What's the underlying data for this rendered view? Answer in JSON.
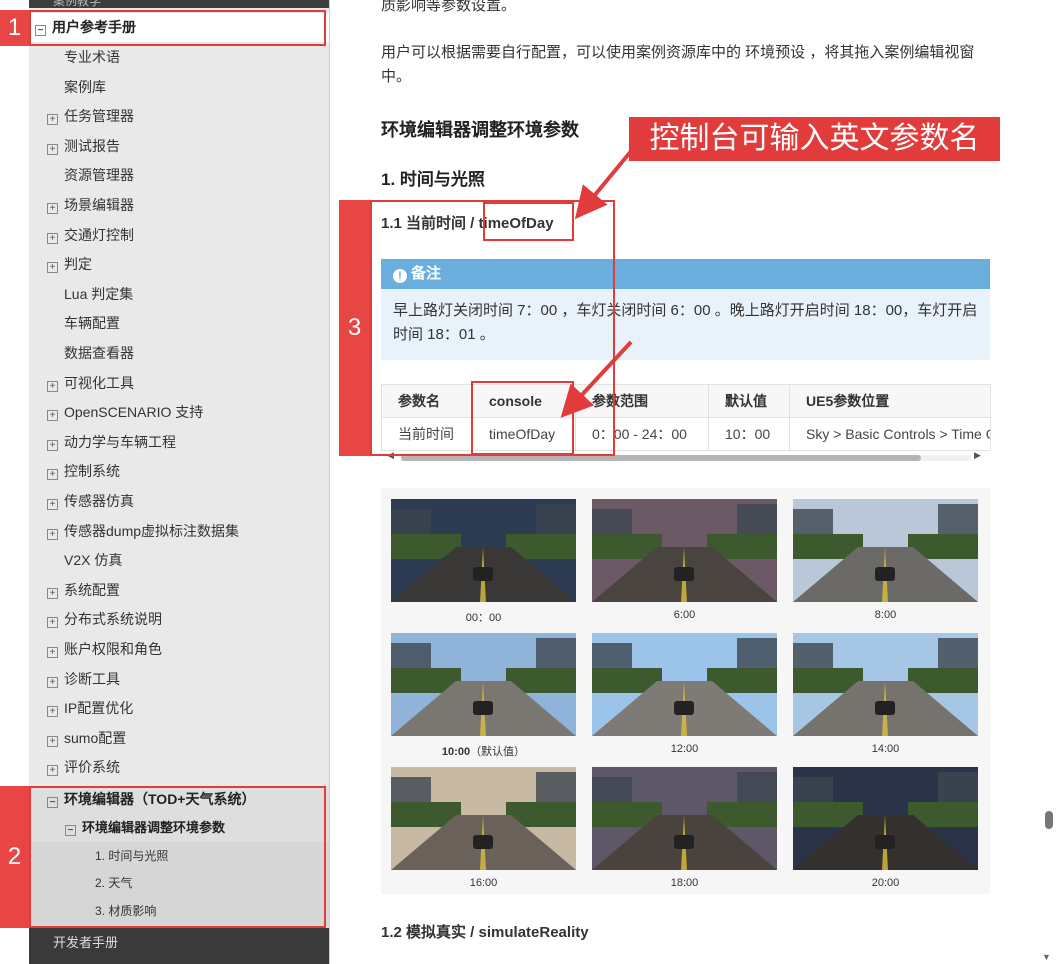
{
  "sidebar": {
    "top_partial": "案例教学",
    "root": "用户参考手册",
    "items": [
      {
        "label": "专业术语",
        "expandable": false
      },
      {
        "label": "案例库",
        "expandable": false
      },
      {
        "label": "任务管理器",
        "expandable": true
      },
      {
        "label": "测试报告",
        "expandable": true
      },
      {
        "label": "资源管理器",
        "expandable": false
      },
      {
        "label": "场景编辑器",
        "expandable": true
      },
      {
        "label": "交通灯控制",
        "expandable": true
      },
      {
        "label": "判定",
        "expandable": true
      },
      {
        "label": "Lua 判定集",
        "expandable": false
      },
      {
        "label": "车辆配置",
        "expandable": false
      },
      {
        "label": "数据查看器",
        "expandable": false
      },
      {
        "label": "可视化工具",
        "expandable": true
      },
      {
        "label": "OpenSCENARIO 支持",
        "expandable": true
      },
      {
        "label": "动力学与车辆工程",
        "expandable": true
      },
      {
        "label": "控制系统",
        "expandable": true
      },
      {
        "label": "传感器仿真",
        "expandable": true
      },
      {
        "label": "传感器dump虚拟标注数据集",
        "expandable": true
      },
      {
        "label": "V2X 仿真",
        "expandable": false
      },
      {
        "label": "系统配置",
        "expandable": true
      },
      {
        "label": "分布式系统说明",
        "expandable": true
      },
      {
        "label": "账户权限和角色",
        "expandable": true
      },
      {
        "label": "诊断工具",
        "expandable": true
      },
      {
        "label": "IP配置优化",
        "expandable": true
      },
      {
        "label": "sumo配置",
        "expandable": true
      },
      {
        "label": "评价系统",
        "expandable": true
      }
    ],
    "env_editor": "环境编辑器（TOD+天气系统）",
    "env_adjust": "环境编辑器调整环境参数",
    "env_sub": [
      "1. 时间与光照",
      "2. 天气",
      "3. 材质影响"
    ],
    "bottom_partial": "开发者手册",
    "tags": [
      "1",
      "2",
      "3"
    ]
  },
  "main": {
    "top_partial": "质影响等参数设置。",
    "intro": "用户可以根据需要自行配置，可以使用案例资源库中的 环境预设 ，将其拖入案例编辑视窗中。",
    "section_title": "环境编辑器调整环境参数",
    "sub_title": "1. 时间与光照",
    "item_title_prefix": "1.1 当前时间 / ",
    "item_title_key": "timeOfDay",
    "note_title": "备注",
    "note_text": "早上路灯关闭时间 7：00 ，车灯关闭时间 6：00 。晚上路灯开启时间 18：00，车灯开启时间 18：01 。",
    "table_headers": [
      "参数名",
      "console",
      "参数范围",
      "默认值",
      "UE5参数位置"
    ],
    "table_rows": [
      [
        "当前时间",
        "timeOfDay",
        "0：00 - 24：00",
        "10：00",
        "Sky > Basic Controls > Time Of Day"
      ]
    ],
    "gallery": [
      {
        "caption": "00：00",
        "bold": ""
      },
      {
        "caption": "6:00",
        "bold": ""
      },
      {
        "caption": "8:00",
        "bold": ""
      },
      {
        "caption": "（默认值）",
        "bold": "10:00"
      },
      {
        "caption": "12:00",
        "bold": ""
      },
      {
        "caption": "14:00",
        "bold": ""
      },
      {
        "caption": "16:00",
        "bold": ""
      },
      {
        "caption": "18:00",
        "bold": ""
      },
      {
        "caption": "20:00",
        "bold": ""
      }
    ],
    "next_title": "1.2 模拟真实 / simulateReality"
  },
  "annotation_banner": "控制台可输入英文参数名",
  "colors": {
    "accent_red": "#e23b3b",
    "note_blue": "#6aaedd",
    "sidebar_bg": "#e9e9e9"
  }
}
